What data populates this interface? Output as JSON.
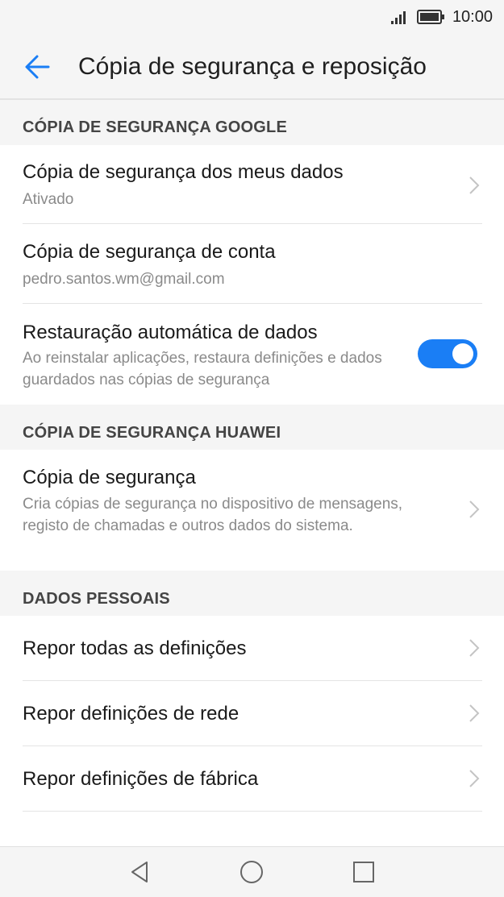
{
  "status_bar": {
    "time": "10:00",
    "signal_icon": "signal-icon",
    "battery_icon": "battery-icon"
  },
  "app_bar": {
    "title": "Cópia de segurança e reposição",
    "back_icon": "back-arrow-icon"
  },
  "sections": {
    "google": {
      "header": "CÓPIA DE SEGURANÇA GOOGLE",
      "items": [
        {
          "title": "Cópia de segurança dos meus dados",
          "subtitle": "Ativado"
        },
        {
          "title": "Cópia de segurança de conta",
          "subtitle": "pedro.santos.wm@gmail.com"
        },
        {
          "title": "Restauração automática de dados",
          "subtitle": "Ao reinstalar aplicações, restaura definições e dados guardados nas cópias de segurança",
          "toggle_on": true
        }
      ]
    },
    "huawei": {
      "header": "CÓPIA DE SEGURANÇA HUAWEI",
      "items": [
        {
          "title": "Cópia de segurança",
          "subtitle": "Cria cópias de segurança no dispositivo de mensagens, registo de chamadas e outros dados do sistema."
        }
      ]
    },
    "personal": {
      "header": "DADOS PESSOAIS",
      "items": [
        {
          "title": "Repor todas as definições"
        },
        {
          "title": "Repor definições de rede"
        },
        {
          "title": "Repor definições de fábrica"
        }
      ]
    }
  },
  "colors": {
    "accent": "#1a7ef5",
    "background": "#f5f5f5",
    "card": "#ffffff"
  },
  "nav_bar": {
    "icons": [
      "back-triangle-icon",
      "home-circle-icon",
      "recents-square-icon"
    ]
  }
}
